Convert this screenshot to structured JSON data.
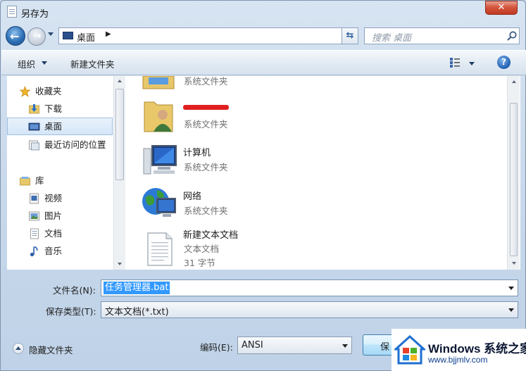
{
  "window": {
    "title": "另存为",
    "close_glyph": "✕"
  },
  "address": {
    "location": "桌面",
    "search_placeholder": "搜索 桌面"
  },
  "toolbar": {
    "organize": "组织",
    "new_folder": "新建文件夹",
    "help": "?"
  },
  "nav": {
    "favorites": "收藏夹",
    "downloads": "下载",
    "desktop": "桌面",
    "recent": "最近访问的位置",
    "libraries": "库",
    "videos": "视频",
    "pictures": "图片",
    "documents": "文档",
    "music": "音乐"
  },
  "files": [
    {
      "name": "",
      "type": "系统文件夹",
      "icon": "library-folder-icon"
    },
    {
      "name": "",
      "type": "系统文件夹",
      "icon": "user-folder-icon",
      "redacted": true
    },
    {
      "name": "计算机",
      "type": "系统文件夹",
      "icon": "computer-icon"
    },
    {
      "name": "网络",
      "type": "系统文件夹",
      "icon": "network-icon"
    },
    {
      "name": "新建文本文档",
      "type": "文本文档",
      "size": "31 字节",
      "icon": "text-file-icon"
    }
  ],
  "form": {
    "filename_label": "文件名(N):",
    "filename_value": "任务管理器.bat",
    "savetype_label": "保存类型(T):",
    "savetype_value": "文本文档(*.txt)",
    "hide_folders": "隐藏文件夹",
    "encoding_label": "编码(E):",
    "encoding_value": "ANSI",
    "save_button": "保"
  },
  "watermark": {
    "brand": "Windows 系统之家",
    "url": "www.bjjmlv.com"
  },
  "colors": {
    "selection": "#3399ff",
    "accent": "#1f5eb0",
    "redaction": "#e02020"
  }
}
